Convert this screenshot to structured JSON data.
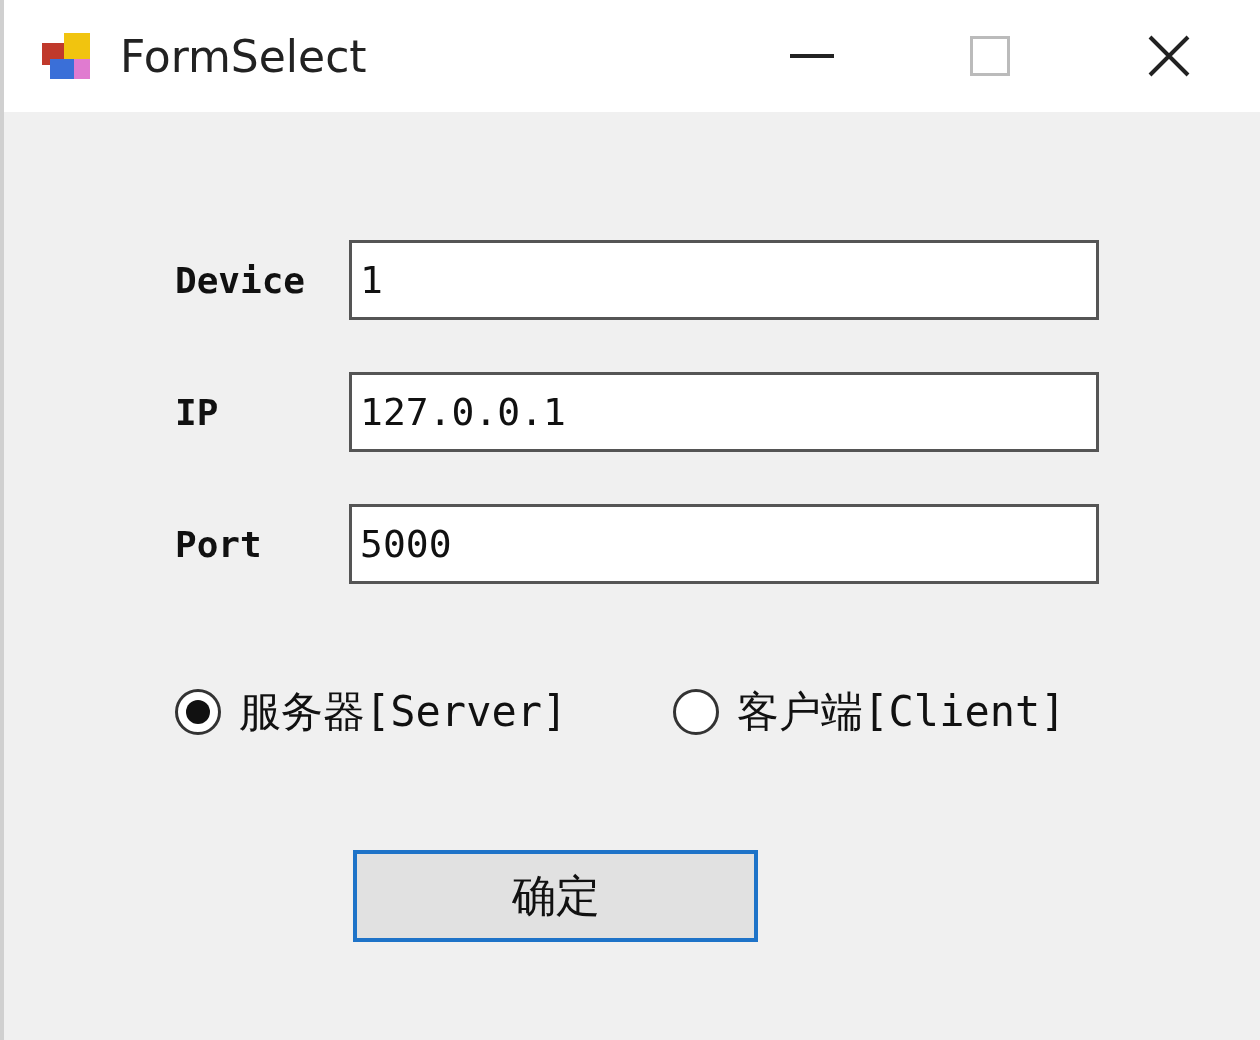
{
  "window": {
    "title": "FormSelect"
  },
  "fields": [
    {
      "label": "Device",
      "value": "1"
    },
    {
      "label": "IP",
      "value": "127.0.0.1"
    },
    {
      "label": "Port",
      "value": "5000"
    }
  ],
  "modes": [
    {
      "label": "服务器[Server]",
      "selected": true
    },
    {
      "label": "客户端[Client]",
      "selected": false
    }
  ],
  "buttons": [
    "确定"
  ]
}
